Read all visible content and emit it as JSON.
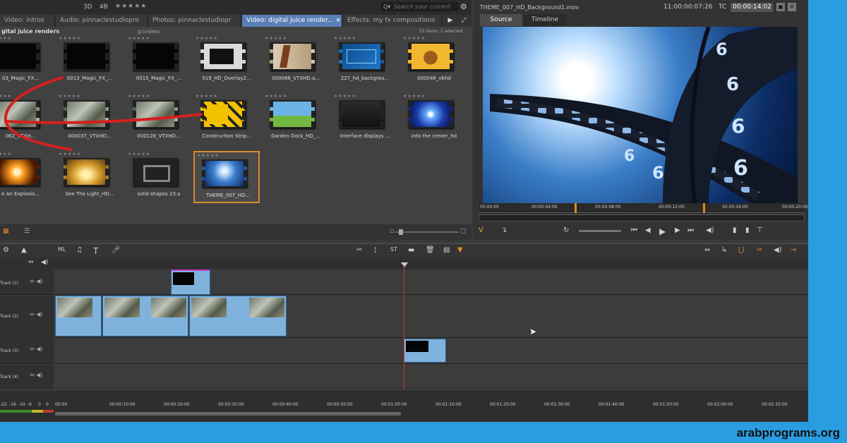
{
  "topbar": {
    "mode_3d": "3D",
    "mode_4b": "4B",
    "stars": "★★★★★",
    "search_placeholder": "Search your current view"
  },
  "library_tabs": [
    {
      "label": "Video: intros",
      "active": false
    },
    {
      "label": "Audio: pinnaclestudiopro",
      "active": false
    },
    {
      "label": "Photos: pinnaclestudiopr",
      "active": false
    },
    {
      "label": "Video: digital juice render...",
      "active": true
    },
    {
      "label": "Effects: my fx compositions",
      "active": false
    }
  ],
  "library": {
    "heading": "gital juice renders",
    "subheading": "g:\\videos",
    "count": "55 items, 1 selected",
    "items": [
      {
        "caption": "03_Magic_FX...",
        "style": "t-black"
      },
      {
        "caption": "0013_Magic_FX_...",
        "style": "t-black"
      },
      {
        "caption": "0015_Magic_FX_...",
        "style": "t-black"
      },
      {
        "caption": "019_HD_Overlay2...",
        "style": "t-overlay"
      },
      {
        "caption": "000068_VTXHD.a...",
        "style": "t-legs"
      },
      {
        "caption": "227_hd_backgrou...",
        "style": "t-blueui"
      },
      {
        "caption": "000046_vbhd",
        "style": "t-ball"
      },
      {
        "caption": "062_VTXH...",
        "style": "t-photo"
      },
      {
        "caption": "000037_VTXHD...",
        "style": "t-photo"
      },
      {
        "caption": "000128_VTXHD...",
        "style": "t-photo"
      },
      {
        "caption": "Construction Strip...",
        "style": "t-const"
      },
      {
        "caption": "Garden Dock_HD_...",
        "style": "t-grass"
      },
      {
        "caption": "interface displays ...",
        "style": "t-dark"
      },
      {
        "caption": "into the center_hd",
        "style": "t-burst"
      },
      {
        "caption": "e An Explosio...",
        "style": "t-expl"
      },
      {
        "caption": "See The Light_HD...",
        "style": "t-light"
      },
      {
        "caption": "solid shapes 23.a",
        "style": "t-solid"
      },
      {
        "caption": "THEME_007_HD...",
        "style": "t-theme",
        "selected": true
      }
    ]
  },
  "player": {
    "title": "THEME_007_HD_Background1.mov",
    "duration": "11:00:00:07:26",
    "tc_label": "TC",
    "timecode": "00:00:14:02",
    "tabs": [
      {
        "label": "Source",
        "active": true
      },
      {
        "label": "Timeline",
        "active": false
      }
    ],
    "ruler": [
      "00:00:00",
      "00:00:04:00",
      "00:00:08:00",
      "00:00:12:00",
      "00:00:16:00",
      "00:00:20:00"
    ]
  },
  "timeline": {
    "tracks": [
      {
        "name": "Track (1)"
      },
      {
        "name": "Track (2)"
      },
      {
        "name": "Track (3)"
      },
      {
        "name": "Track (4)"
      }
    ],
    "ruler": [
      "00:00",
      "00:00:10:00",
      "00:00:20:00",
      "00:00:30:00",
      "00:00:40:00",
      "00:00:50:00",
      "00:01:00:00",
      "00:01:10:00",
      "00:01:20:00",
      "00:01:30:00",
      "00:01:40:00",
      "00:01:50:00",
      "00:02:00:00",
      "00:02:10:00"
    ],
    "vu": [
      "-22",
      "-16",
      "-10",
      "-6",
      "-3",
      "0"
    ]
  },
  "watermark": "arabprograms.org"
}
